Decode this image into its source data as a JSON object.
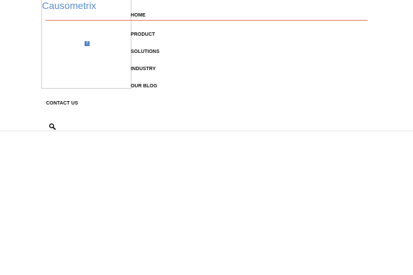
{
  "site": {
    "logo_text": "Causometrix",
    "logo_alt_icon": "broken-image-icon"
  },
  "nav": {
    "home": "HOME",
    "product": "PRODUCT",
    "solutions": "SOLUTIONS",
    "industry": "INDUSTRY",
    "blog": "OUR BLOG",
    "contact": "CONTACT US"
  },
  "search": {
    "icon": "search-icon"
  },
  "colors": {
    "logo": "#5b8fd2",
    "accent_rule": "#e07a5f",
    "nav_text": "#111111"
  }
}
